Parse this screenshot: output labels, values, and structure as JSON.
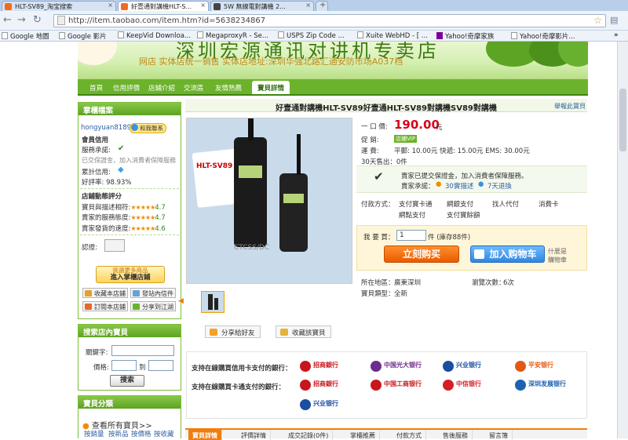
{
  "browser": {
    "tabs": [
      {
        "label": "HLT-SV89_淘宝搜索",
        "active": false
      },
      {
        "label": "好壹通對講機HLT-S...",
        "active": true
      },
      {
        "label": "5W 無線電對講機 2...",
        "active": false
      }
    ],
    "url": "http://item.taobao.com/item.htm?id=5638234867",
    "bookmarks": [
      "Google 地圖",
      "Google 影片",
      "KeepVid Downloa...",
      "MegaproxyR - Se...",
      "USPS Zip Code ...",
      "Xuite WebHD - [ ...",
      "Yahoo!奇摩家族",
      "Yahoo!奇摩影片..."
    ]
  },
  "shop": {
    "banner_title": "深圳宏源通讯对讲机专卖店",
    "banner_sub": "网店  实体店统一销售   实体店地址:深圳华强北路汇通安防市场A037档",
    "nav": [
      "首頁",
      "信用評價",
      "店鋪介紹",
      "交流區",
      "友情熱薦",
      "寶貝詳情"
    ]
  },
  "sidebar": {
    "seller_title": "掌櫃檔案",
    "seller_name": "hongyuan8189",
    "contact_btn": "和我聯系",
    "credit_title": "會員信用",
    "service_label": "服務承諾:",
    "protect_text": "已交保證金，加入消費者保障服務",
    "credit_label": "累計信用:",
    "rate_label": "好評率:",
    "rate_value": "98.93%",
    "ratings_title": "店鋪動態評分",
    "ratings": [
      {
        "label": "寶貝與描述相符:",
        "value": "4.7"
      },
      {
        "label": "賣家的服務態度:",
        "value": "4.7"
      },
      {
        "label": "賣家發貨的速度:",
        "value": "4.6"
      }
    ],
    "cert_label": "認證:",
    "enter_shop_top": "挑選更多商品",
    "enter_shop": "進入掌櫃店鋪",
    "actions": [
      "收藏本店鋪",
      "發站內信件",
      "訂閱本店鋪",
      "分享到江湖"
    ],
    "search_title": "搜索店內寶貝",
    "keyword_label": "關鍵字:",
    "price_label": "價格:",
    "to_label": "到",
    "search_btn": "搜索",
    "category_title": "寶貝分類",
    "all_items": "查看所有寶貝>>",
    "sort_links": [
      "按銷量",
      "按新品",
      "按價格",
      "按收藏"
    ]
  },
  "product": {
    "title": "好壹通對講機HLT-SV89好壹通HLT-SV89對講機SV89對講機",
    "report": "舉報此寶貝",
    "price_label": "一 口 價:",
    "price": "190.00",
    "price_unit": "元",
    "promo_label": "促    銷:",
    "promo_badge": "店鋪VIP",
    "shipping_label": "運    費:",
    "shipping": "平郵: 10.00元 快遞: 15.00元 EMS: 30.00元",
    "sold": "30天售出：0件",
    "guarantee": "賣家已提交保證金，加入消費者保障服務。",
    "promise_label": "賣家承諾：",
    "promise_1": "30實描述",
    "promise_2": "7天退換",
    "pay_label": "付款方式：",
    "pay_methods": [
      "支付寶卡通",
      "網銀支付",
      "找人代付",
      "消費卡",
      "網點支付",
      "支付寶餘額"
    ],
    "qty_label": "我 要 買：",
    "qty_value": "1",
    "stock": "件 (庫存88件)",
    "buy_now": "立刻购买",
    "add_cart": "加入购物车",
    "what_cart_1": "什麼是",
    "what_cart_2": "購物車",
    "location_label": "所在地區：",
    "location": "廣東深圳",
    "views_label": "瀏覽次數：",
    "views": "6次",
    "type_label": "寶貝類型：",
    "type": "全新",
    "share_friend": "分享給好友",
    "fav_item": "收藏該寶貝",
    "photo_text": [
      "HLT-SV89",
      "CTCSS/DC"
    ]
  },
  "payment": {
    "credit_line": "支持在線購買信用卡支付的銀行：",
    "debit_line": "支持在線購買卡通支付的銀行：",
    "banks_row1": [
      {
        "name": "招商銀行",
        "color": "#c8161d"
      },
      {
        "name": "中国光大银行",
        "color": "#6d2d8e"
      },
      {
        "name": "兴业银行",
        "color": "#1a4ea1"
      },
      {
        "name": "平安银行",
        "color": "#e25a12"
      }
    ],
    "banks_row2": [
      {
        "name": "招商銀行",
        "color": "#c8161d"
      },
      {
        "name": "中国工商银行",
        "color": "#c8161d"
      },
      {
        "name": "中信银行",
        "color": "#d41f26"
      },
      {
        "name": "深圳发展银行",
        "color": "#1d62b0"
      }
    ],
    "banks_row3": [
      {
        "name": "兴业银行",
        "color": "#1a4ea1"
      }
    ]
  },
  "bottom_tabs": [
    "寶貝詳情",
    "評價詳情",
    "成交記錄(0件)",
    "掌櫃推薦",
    "付款方式",
    "售後服務",
    "留言簿"
  ],
  "colors": {
    "accent_green": "#6cb22c",
    "price_red": "#d9001b",
    "buy_orange": "#ea5b00",
    "cart_blue": "#2f86e0"
  }
}
